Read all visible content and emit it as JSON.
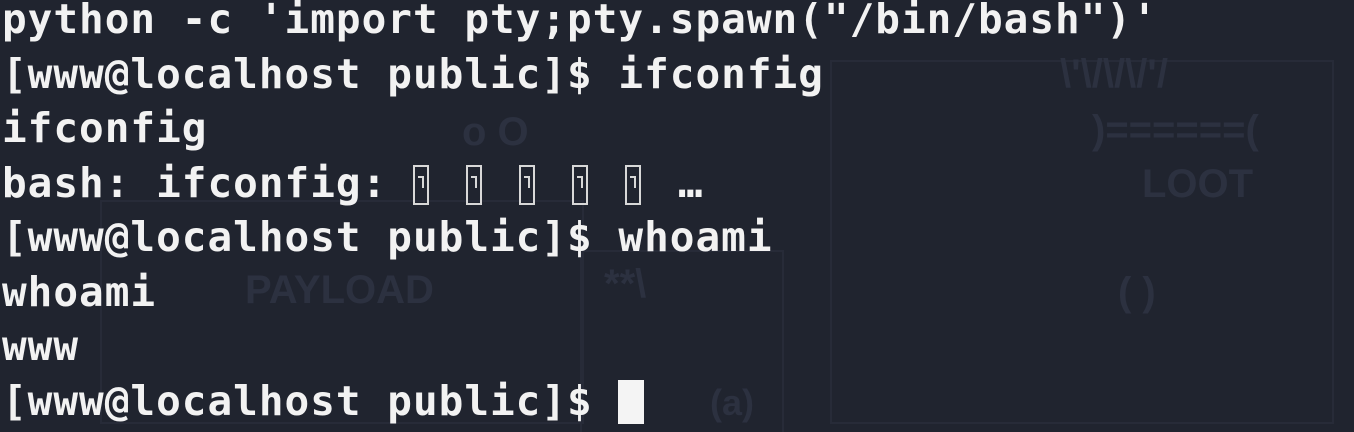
{
  "background_art": {
    "label_payload": "PAYLOAD",
    "label_loot": "LOOT",
    "art_top": "\\'\\/\\/\\/'/",
    "art_eq": ")======(",
    "art_o": "o O",
    "art_arrow": "**\\",
    "art_paren": "( )",
    "art_at": "(a)"
  },
  "terminal": {
    "lines": [
      "python -c 'import pty;pty.spawn(\"/bin/bash\")'",
      "[www@localhost public]$ ifconfig",
      "ifconfig",
      "bash: ifconfig: ",
      "[www@localhost public]$ whoami",
      "whoami",
      "www",
      "[www@localhost public]$ "
    ],
    "error_suffix": "…",
    "unknown_glyph_count": 5
  },
  "colors": {
    "background": "#20242f",
    "text": "#f2f2f2",
    "cursor": "#f4f4f4"
  }
}
